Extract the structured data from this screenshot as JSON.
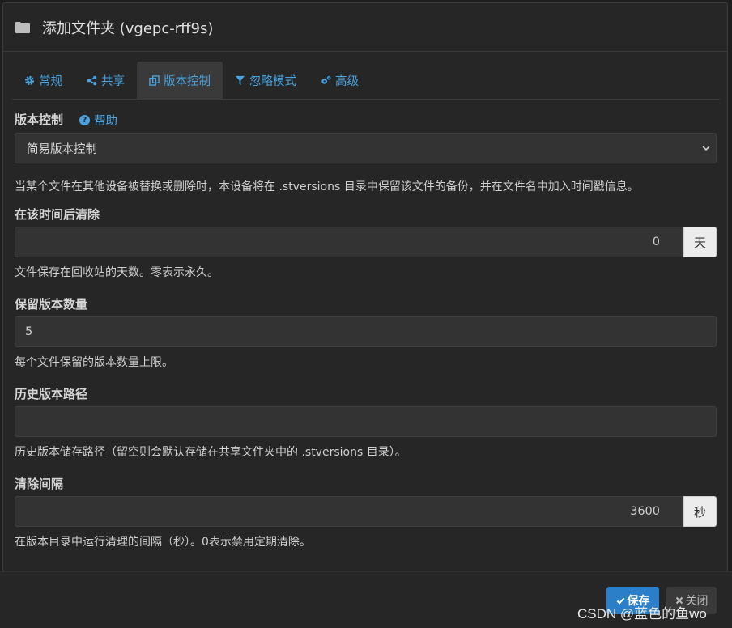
{
  "modal": {
    "title": "添加文件夹 (vgepc-rff9s)"
  },
  "tabs": [
    {
      "label": "常规",
      "icon": "gear-icon"
    },
    {
      "label": "共享",
      "icon": "share-icon"
    },
    {
      "label": "版本控制",
      "icon": "copy-icon",
      "active": true
    },
    {
      "label": "忽略模式",
      "icon": "filter-icon"
    },
    {
      "label": "高级",
      "icon": "gears-icon"
    }
  ],
  "versioning": {
    "label": "版本控制",
    "help_label": "帮助",
    "selected": "简易版本控制",
    "description": "当某个文件在其他设备被替换或删除时，本设备将在 .stversions 目录中保留该文件的备份，并在文件名中加入时间戳信息。"
  },
  "cleanout": {
    "label": "在该时间后清除",
    "value": "0",
    "unit": "天",
    "description": "文件保存在回收站的天数。零表示永久。"
  },
  "keep": {
    "label": "保留版本数量",
    "value": "5",
    "description": "每个文件保留的版本数量上限。"
  },
  "path": {
    "label": "历史版本路径",
    "value": "",
    "description": "历史版本储存路径（留空则会默认存储在共享文件夹中的 .stversions 目录）。"
  },
  "interval": {
    "label": "清除间隔",
    "value": "3600",
    "unit": "秒",
    "description": "在版本目录中运行清理的间隔（秒）。0表示禁用定期清除。"
  },
  "footer": {
    "save_label": "保存",
    "close_label": "关闭"
  },
  "watermark": "CSDN @蓝色的鱼wo",
  "colors": {
    "accent": "#4aa3df",
    "primary_button": "#2a7fc8",
    "background": "#262626"
  }
}
